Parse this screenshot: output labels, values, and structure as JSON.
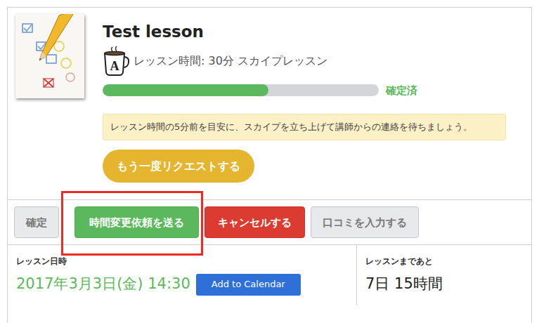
{
  "lesson": {
    "title": "Test lesson",
    "icon_letter": "A",
    "meta": "レッスン時間: 30分 スカイプレッスン",
    "progress": {
      "level": 0.6,
      "label": "確定済"
    },
    "notice": "レッスン時間の5分前を目安に、スカイプを立ち上げて講師からの連絡を待ちましょう。",
    "request_again": "もう一度リクエストする"
  },
  "actions": [
    {
      "label": "確定",
      "kind": "neutral",
      "disabled": true,
      "highlighted": false
    },
    {
      "label": "時間変更依頼を送る",
      "kind": "success",
      "disabled": false,
      "highlighted": true
    },
    {
      "label": "キャンセルする",
      "kind": "danger",
      "disabled": false,
      "highlighted": false
    },
    {
      "label": "口コミを入力する",
      "kind": "neutral",
      "disabled": true,
      "highlighted": false
    }
  ],
  "schedule": {
    "date_label": "レッスン日時",
    "date": "2017年3月3日(金) 14:30",
    "calendar_button": "Add to Calendar",
    "remaining_label": "レッスンまであと",
    "remaining": "7日 15時間"
  }
}
